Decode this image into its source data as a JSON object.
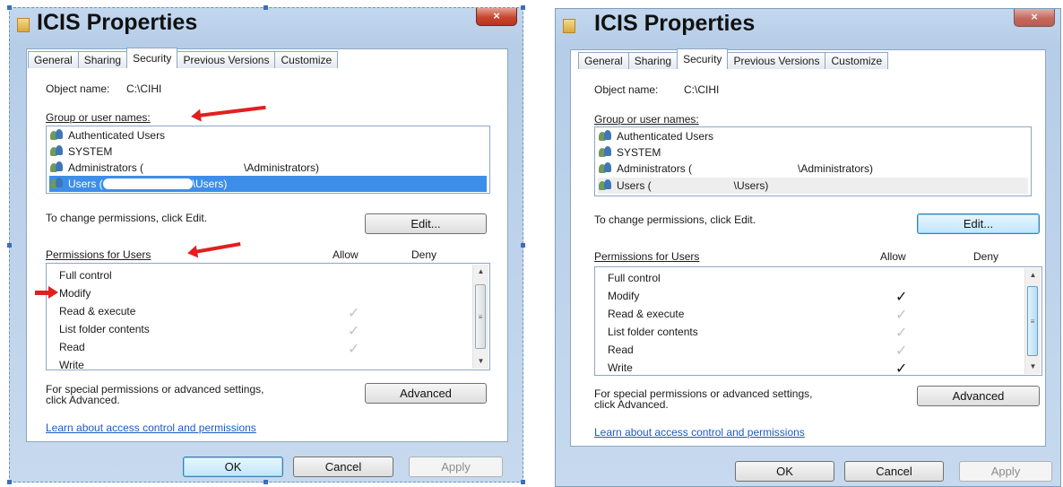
{
  "dialogs": [
    {
      "title": "ICIS Properties",
      "close_glyph": "×",
      "tabs": [
        "General",
        "Sharing",
        "Security",
        "Previous Versions",
        "Customize"
      ],
      "active_tab": "Security",
      "object_name_label": "Object name:",
      "object_name_value": "C:\\CIHI",
      "group_label": "Group or user names:",
      "users": [
        {
          "prefix": "Authenticated Users",
          "suffix": ""
        },
        {
          "prefix": "SYSTEM",
          "suffix": ""
        },
        {
          "prefix": "Administrators (",
          "suffix": "\\Administrators)"
        },
        {
          "prefix": "Users (",
          "suffix": "\\Users)"
        }
      ],
      "selected_user_index": 3,
      "change_perm_text": "To change permissions, click Edit.",
      "edit_button": "Edit...",
      "permissions_label": "Permissions for Users",
      "allow_header": "Allow",
      "deny_header": "Deny",
      "permissions": [
        {
          "name": "Full control",
          "allow": "none"
        },
        {
          "name": "Modify",
          "allow": "none"
        },
        {
          "name": "Read & execute",
          "allow": "inherited"
        },
        {
          "name": "List folder contents",
          "allow": "inherited"
        },
        {
          "name": "Read",
          "allow": "inherited"
        },
        {
          "name": "Write",
          "allow": "none"
        }
      ],
      "special_text_1": "For special permissions or advanced settings,",
      "special_text_2": "click Advanced.",
      "advanced_button": "Advanced",
      "learn_link": "Learn about access control and permissions",
      "ok_button": "OK",
      "cancel_button": "Cancel",
      "apply_button": "Apply"
    },
    {
      "title": "ICIS Properties",
      "close_glyph": "×",
      "tabs": [
        "General",
        "Sharing",
        "Security",
        "Previous Versions",
        "Customize"
      ],
      "active_tab": "Security",
      "object_name_label": "Object name:",
      "object_name_value": "C:\\CIHI",
      "group_label": "Group or user names:",
      "users": [
        {
          "prefix": "Authenticated Users",
          "suffix": ""
        },
        {
          "prefix": "SYSTEM",
          "suffix": ""
        },
        {
          "prefix": "Administrators (",
          "suffix": "\\Administrators)"
        },
        {
          "prefix": "Users (",
          "suffix": "\\Users)"
        }
      ],
      "selected_user_index": 3,
      "change_perm_text": "To change permissions, click Edit.",
      "edit_button": "Edit...",
      "permissions_label": "Permissions for Users",
      "allow_header": "Allow",
      "deny_header": "Deny",
      "permissions": [
        {
          "name": "Full control",
          "allow": "none"
        },
        {
          "name": "Modify",
          "allow": "explicit"
        },
        {
          "name": "Read & execute",
          "allow": "inherited"
        },
        {
          "name": "List folder contents",
          "allow": "inherited"
        },
        {
          "name": "Read",
          "allow": "inherited"
        },
        {
          "name": "Write",
          "allow": "explicit"
        }
      ],
      "special_text_1": "For special permissions or advanced settings,",
      "special_text_2": "click Advanced.",
      "advanced_button": "Advanced",
      "learn_link": "Learn about access control and permissions",
      "ok_button": "OK",
      "cancel_button": "Cancel",
      "apply_button": "Apply"
    }
  ],
  "check_glyph": "✓",
  "colors": {
    "annotation_arrow": "#e21f1f",
    "selection": "#3d8ee9",
    "link": "#1a5bc4"
  }
}
